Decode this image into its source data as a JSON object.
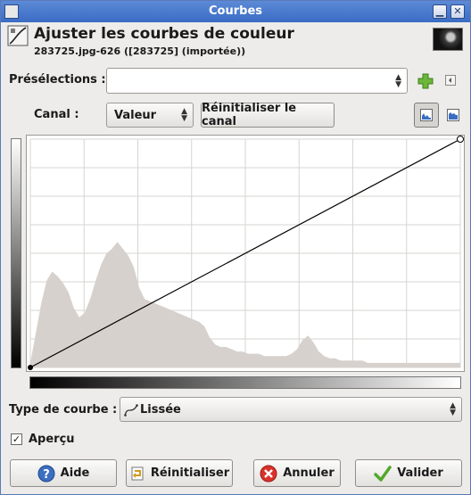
{
  "window": {
    "title": "Courbes"
  },
  "header": {
    "title": "Ajuster les courbes de couleur",
    "subtitle": "283725.jpg-626 ([283725] (importée))"
  },
  "presets": {
    "label": "Présélections :",
    "value": ""
  },
  "channel": {
    "label": "Canal :",
    "value": "Valeur",
    "reset_label": "Réinitialiser le canal"
  },
  "curve_type": {
    "label": "Type de courbe :",
    "value": "Lissée"
  },
  "preview": {
    "label": "Aperçu",
    "checked": true
  },
  "buttons": {
    "help": "Aide",
    "reset": "Réinitialiser",
    "cancel": "Annuler",
    "ok": "Valider"
  },
  "colors": {
    "titlebar": "#3a6cc4",
    "histogram": "#d7d1cd",
    "add_icon": "#6cb63a",
    "cancel_icon": "#d9322a",
    "help_icon": "#3b6fc2",
    "ok_icon": "#52a829"
  },
  "histogram": {
    "bins": [
      0.02,
      0.15,
      0.28,
      0.38,
      0.42,
      0.4,
      0.37,
      0.33,
      0.26,
      0.22,
      0.24,
      0.3,
      0.38,
      0.45,
      0.5,
      0.52,
      0.55,
      0.52,
      0.49,
      0.44,
      0.35,
      0.3,
      0.29,
      0.28,
      0.27,
      0.26,
      0.25,
      0.24,
      0.23,
      0.22,
      0.21,
      0.2,
      0.18,
      0.13,
      0.1,
      0.09,
      0.09,
      0.08,
      0.07,
      0.07,
      0.06,
      0.06,
      0.06,
      0.05,
      0.05,
      0.05,
      0.05,
      0.05,
      0.06,
      0.08,
      0.12,
      0.14,
      0.11,
      0.07,
      0.05,
      0.04,
      0.04,
      0.03,
      0.03,
      0.03,
      0.03,
      0.03,
      0.02,
      0.02,
      0.02,
      0.02,
      0.02,
      0.02,
      0.02,
      0.02,
      0.02,
      0.02,
      0.02,
      0.02,
      0.02,
      0.02,
      0.02,
      0.02,
      0.02,
      0.02
    ]
  },
  "curve": {
    "points": [
      [
        0,
        0
      ],
      [
        1,
        1
      ]
    ]
  }
}
